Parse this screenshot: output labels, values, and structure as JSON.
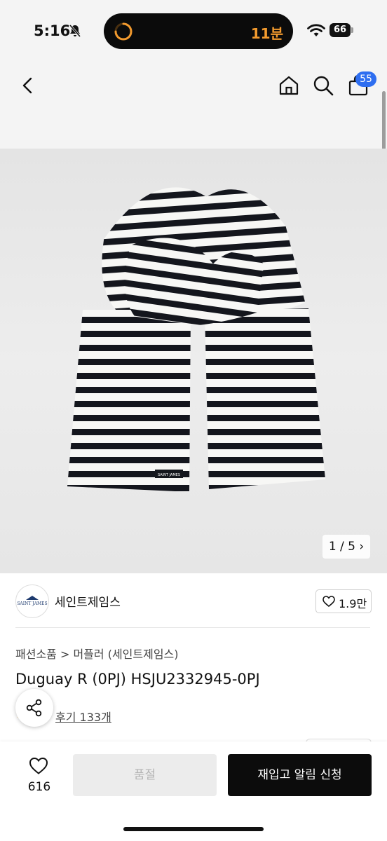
{
  "status_bar": {
    "time": "5:16",
    "island_text": "11분",
    "battery": "66"
  },
  "nav": {
    "cart_badge": "55"
  },
  "gallery": {
    "pager": "1 / 5 ›",
    "brand_label_on_scarf": "SAINT JAMES"
  },
  "brand": {
    "logo_text": "SAINT JAMES",
    "name": "세인트제임스",
    "likes": "1.9만"
  },
  "product": {
    "breadcrumb": "패션소품 > 머플러 (세인트제임스)",
    "title": "Duguay R (0PJ) HSJU2332945-0PJ",
    "review_link": "후기 133개"
  },
  "bottom": {
    "wish_count": "616",
    "soldout_label": "품절",
    "restock_label": "재입고 알림 신청"
  },
  "colors": {
    "accent_badge": "#2e6ef0",
    "primary_button": "#0c0c0c",
    "timer": "#f29a2e"
  }
}
